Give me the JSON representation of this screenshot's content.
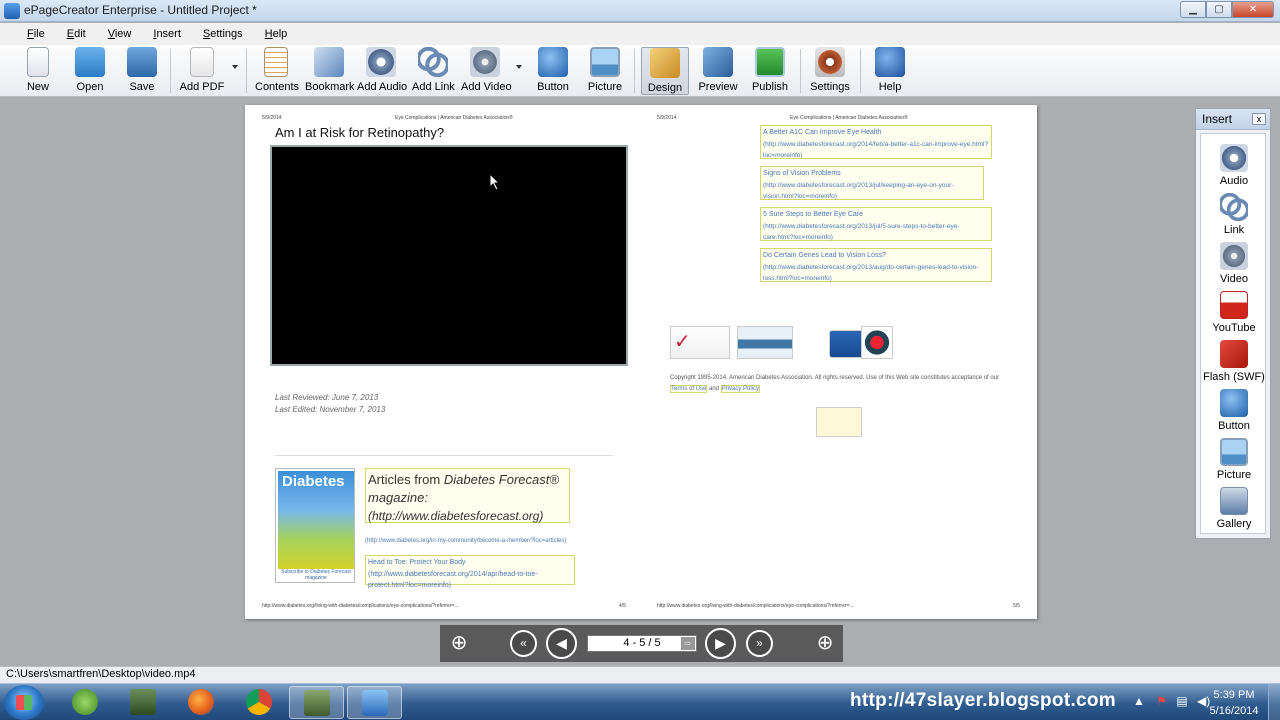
{
  "window": {
    "title": "ePageCreator Enterprise - Untitled Project *"
  },
  "window_buttons": {
    "minimize": "▁",
    "maximize": "▢",
    "close": "✕"
  },
  "menu": [
    "File",
    "Edit",
    "View",
    "Insert",
    "Settings",
    "Help"
  ],
  "toolbar": {
    "new": "New",
    "open": "Open",
    "save": "Save",
    "add_pdf": "Add PDF",
    "contents": "Contents",
    "bookmark": "Bookmark",
    "add_audio": "Add Audio",
    "add_link": "Add Link",
    "add_video": "Add Video",
    "button": "Button",
    "picture": "Picture",
    "design": "Design",
    "preview": "Preview",
    "publish": "Publish",
    "settings": "Settings",
    "help": "Help"
  },
  "page_left": {
    "header_date": "5/9/2014",
    "header_site": "Eye Complications | American Diabetes Association®",
    "title": "Am I at Risk for Retinopathy?",
    "last_reviewed": "Last Reviewed: June 7, 2013",
    "last_edited": "Last Edited: November 7, 2013",
    "mag_cover_text": "Diabetes",
    "mag_caption": "Subscribe to Diabetes Forecast magazine",
    "articles_line1": "Articles from",
    "articles_italic": "Diabetes Forecast®",
    "articles_line2": "magazine:",
    "articles_url": "(http://www.diabetesforecast.org)",
    "community_link": "(http://www.diabetes.org/in-my-community/become-a-member/?loc=articles)",
    "head_to_toe_title": "Head to Toe: Protect Your Body",
    "head_to_toe_url": "(http://www.diabetesforecast.org/2014/apr/head-to-toe-protect.html?loc=moreinfo)",
    "footer_url": "http://www.diabetes.org/living-with-diabetes/complications/eye-complications/?referrer=...",
    "footer_page": "4/5"
  },
  "page_right": {
    "header_date": "5/9/2014",
    "header_site": "Eye Complications | American Diabetes Association®",
    "links": [
      {
        "title": "A Better A1C Can Improve Eye Health",
        "url": "(http://www.diabetesforecast.org/2014/feb/a-better-a1c-can-improve-eye.html?loc=moreinfo)"
      },
      {
        "title": "Signs of Vision Problems",
        "url": "(http://www.diabetesforecast.org/2013/jul/keeping-an-eye-on-your-vision.html?loc=moreinfo)"
      },
      {
        "title": "5 Sure Steps to Better Eye Care",
        "url": "(http://www.diabetesforecast.org/2013/jul/5-sure-steps-to-better-eye-care.html?loc=moreinfo)"
      },
      {
        "title": "Do Certain Genes Lead to Vision Loss?",
        "url": "(http://www.diabetesforecast.org/2013/aug/do-certain-genes-lead-to-vision-loss.html?loc=moreinfo)"
      }
    ],
    "copyright": "Copyright 1995-2014. American Diabetes Association. All rights reserved. Use of this Web site constitutes acceptance of our",
    "terms": "Terms of Use",
    "and": "and",
    "privacy": "Privacy Policy",
    "footer_url": "http://www.diabetes.org/living-with-diabetes/complications/eye-complications/?referrer=...",
    "footer_page": "5/5"
  },
  "insert_panel": {
    "title": "Insert",
    "items": [
      "Audio",
      "Link",
      "Video",
      "YouTube",
      "Flash (SWF)",
      "Button",
      "Picture",
      "Gallery"
    ]
  },
  "navbar": {
    "page_value": "4 - 5 / 5"
  },
  "status": {
    "path": "C:\\Users\\smartfren\\Desktop\\video.mp4"
  },
  "taskbar": {
    "watermark": "http://47slayer.blogspot.com",
    "time": "5:39 PM",
    "date": "5/16/2014"
  }
}
